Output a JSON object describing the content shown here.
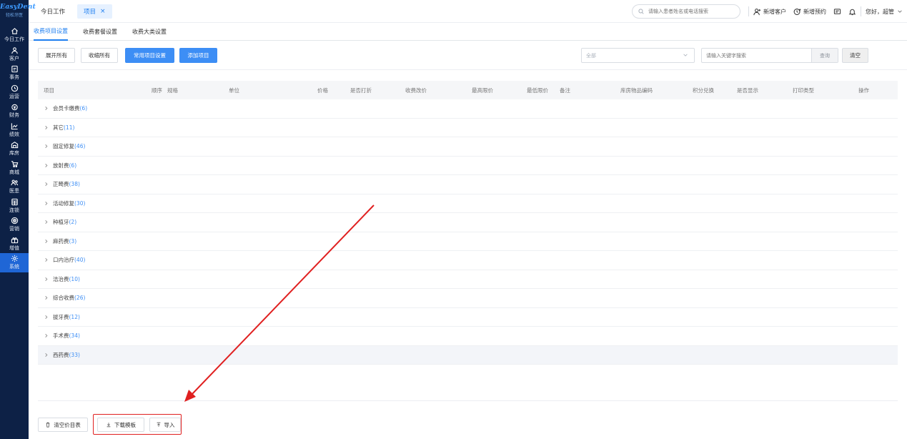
{
  "logo": {
    "main": "EasyDent",
    "sub": "轻松牙医"
  },
  "sidebar": {
    "items": [
      {
        "label": "今日工作",
        "icon": "home-icon"
      },
      {
        "label": "客户",
        "icon": "user-icon"
      },
      {
        "label": "事务",
        "icon": "task-icon"
      },
      {
        "label": "运营",
        "icon": "clock-icon"
      },
      {
        "label": "财务",
        "icon": "money-icon"
      },
      {
        "label": "绩效",
        "icon": "chart-icon"
      },
      {
        "label": "库房",
        "icon": "warehouse-icon"
      },
      {
        "label": "商城",
        "icon": "cart-icon"
      },
      {
        "label": "医患",
        "icon": "doctor-icon"
      },
      {
        "label": "连锁",
        "icon": "chain-icon"
      },
      {
        "label": "营销",
        "icon": "marketing-icon"
      },
      {
        "label": "增值",
        "icon": "value-icon"
      },
      {
        "label": "系统",
        "icon": "gear-icon"
      }
    ],
    "active": "系统"
  },
  "topbar": {
    "tabs": [
      {
        "label": "今日工作"
      },
      {
        "label": "项目",
        "close": "×"
      }
    ],
    "search_placeholder": "请输入患者姓名或电话搜索",
    "new_customer": "新增客户",
    "new_appointment": "新增预约",
    "greeting": "您好，超管"
  },
  "subtabs": [
    "收费项目设置",
    "收费套餐设置",
    "收费大类设置"
  ],
  "toolbar": {
    "expand_all": "展开所有",
    "collapse_all": "收缩所有",
    "common_settings": "常用项目设置",
    "add_item": "添加项目",
    "filter_value": "全部",
    "keyword_placeholder": "请输入关键字搜索",
    "query": "查询",
    "clear": "清空"
  },
  "table": {
    "headers": [
      "项目",
      "顺序",
      "规格",
      "单位",
      "价格",
      "是否打折",
      "收费改价",
      "最高限价",
      "最低限价",
      "备注",
      "库房物品编码",
      "积分兑换",
      "是否显示",
      "打印类型",
      "操作"
    ],
    "rows": [
      {
        "name": "会员卡缴费",
        "count": "(6)"
      },
      {
        "name": "其它",
        "count": "(11)"
      },
      {
        "name": "固定修复",
        "count": "(46)"
      },
      {
        "name": "放射费",
        "count": "(6)"
      },
      {
        "name": "正畸费",
        "count": "(38)"
      },
      {
        "name": "活动修复",
        "count": "(30)"
      },
      {
        "name": "种植牙",
        "count": "(2)"
      },
      {
        "name": "麻药费",
        "count": "(3)"
      },
      {
        "name": "口内治疗",
        "count": "(40)"
      },
      {
        "name": "洁治费",
        "count": "(10)"
      },
      {
        "name": "综合收费",
        "count": "(26)"
      },
      {
        "name": "拔牙费",
        "count": "(12)"
      },
      {
        "name": "手术费",
        "count": "(34)"
      },
      {
        "name": "西药费",
        "count": "(33)"
      }
    ]
  },
  "footer": {
    "clear_price_list": "清空价目表",
    "download_template": "下载模板",
    "import": "导入"
  },
  "colors": {
    "primary": "#3d8ef5",
    "sidebar": "#0d2146",
    "active_nav": "#1f66d6",
    "annotation": "#e02020"
  }
}
